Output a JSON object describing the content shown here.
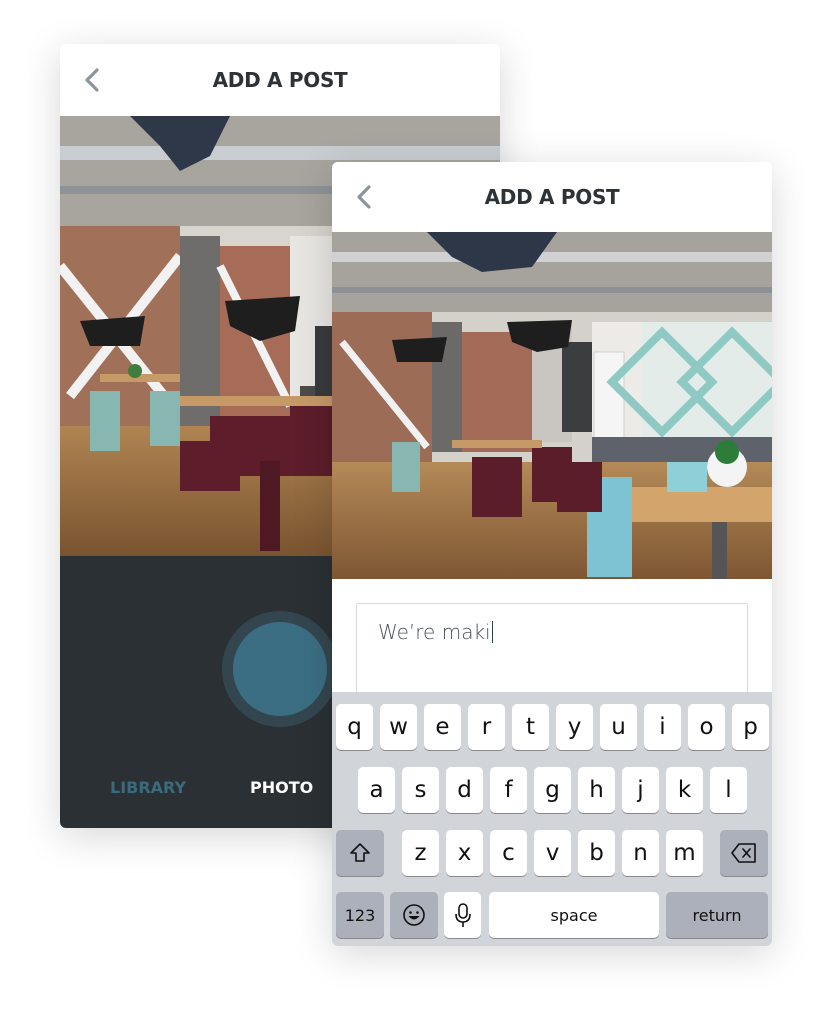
{
  "back_screen": {
    "header": {
      "title": "ADD A POST"
    },
    "camera": {
      "modes": {
        "library": "LIBRARY",
        "photo": "PHOTO"
      }
    }
  },
  "front_screen": {
    "header": {
      "title": "ADD A POST"
    },
    "composer": {
      "value": "We’re maki"
    },
    "keyboard": {
      "row1": [
        "q",
        "w",
        "e",
        "r",
        "t",
        "y",
        "u",
        "i",
        "o",
        "p"
      ],
      "row2": [
        "a",
        "s",
        "d",
        "f",
        "g",
        "h",
        "j",
        "k",
        "l"
      ],
      "row3": [
        "z",
        "x",
        "c",
        "v",
        "b",
        "n",
        "m"
      ],
      "numbers_label": "123",
      "space_label": "space",
      "return_label": "return"
    }
  },
  "colors": {
    "camera_panel": "#2a3034",
    "shutter": "#3b6e83",
    "library_mode": "#3c6a7d",
    "keyboard_bg": "#d1d4d9",
    "func_key": "#abb0ba"
  },
  "icons": [
    "chevron-left-icon",
    "shift-icon",
    "delete-icon",
    "emoji-icon",
    "microphone-icon"
  ]
}
